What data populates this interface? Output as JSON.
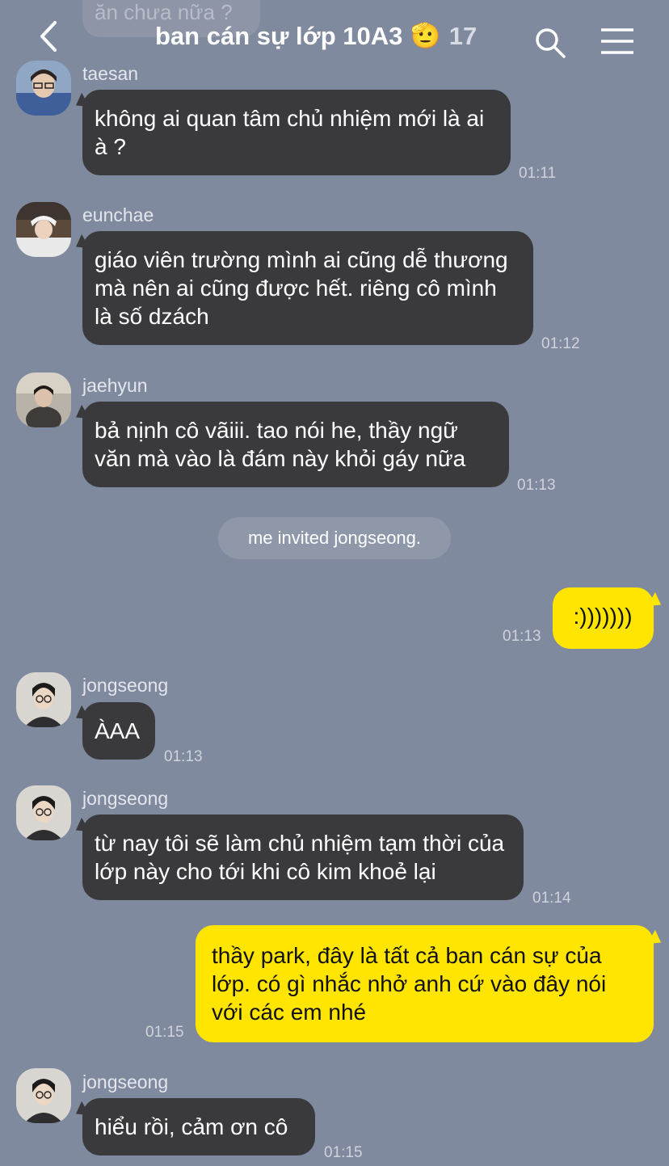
{
  "header": {
    "title": "ban cán sự lớp 10A3",
    "emoji": "🫡",
    "member_count": "17"
  },
  "previous_message_fragment": "ăn chưa nữa ?",
  "system_message": "me invited jongseong.",
  "messages": [
    {
      "sender": "taesan",
      "text": "không ai quan tâm chủ nhiệm mới là ai à ?",
      "time": "01:11"
    },
    {
      "sender": "eunchae",
      "text": "giáo viên trường mình ai cũng dễ thương mà nên ai cũng được hết. riêng cô mình là số dzách",
      "time": "01:12"
    },
    {
      "sender": "jaehyun",
      "text": "bả nịnh cô vãiii. tao nói he, thầy ngữ văn mà vào là đám này khỏi gáy nữa",
      "time": "01:13"
    },
    {
      "sender": "me",
      "text": ":)))))))",
      "time": "01:13"
    },
    {
      "sender": "jongseong",
      "text": "ÀAA",
      "time": "01:13"
    },
    {
      "sender": "jongseong",
      "text": "từ nay tôi sẽ làm chủ nhiệm tạm thời của lớp này cho tới khi cô kim khoẻ lại",
      "time": "01:14"
    },
    {
      "sender": "me",
      "text": "thầy park, đây là tất cả ban cán sự của lớp. có gì nhắc nhở anh cứ vào đây nói với các em nhé",
      "time": "01:15"
    },
    {
      "sender": "jongseong",
      "text": "hiểu rồi, cảm ơn cô",
      "time": "01:15"
    }
  ],
  "colors": {
    "background": "#7f8a9e",
    "incoming_bubble": "#3a3a3c",
    "outgoing_bubble": "#ffe500"
  },
  "icons": [
    "back-arrow-icon",
    "search-icon",
    "menu-icon"
  ]
}
